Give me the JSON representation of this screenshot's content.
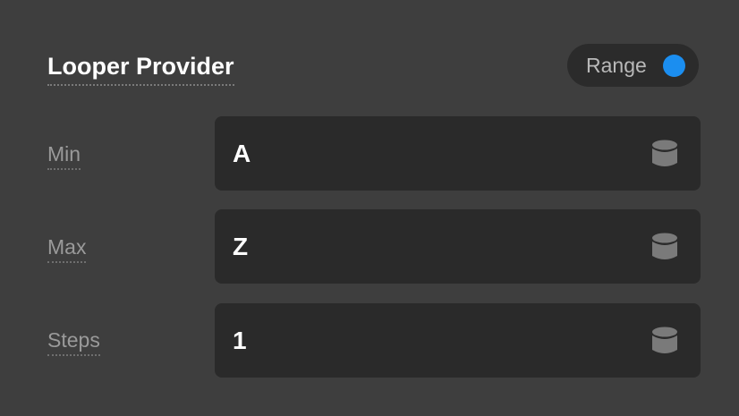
{
  "header": {
    "title": "Looper Provider",
    "range_label": "Range",
    "range_enabled": true,
    "range_color": "#1b8ef0"
  },
  "fields": [
    {
      "label": "Min",
      "value": "A",
      "icon": "database-icon"
    },
    {
      "label": "Max",
      "value": "Z",
      "icon": "database-icon"
    },
    {
      "label": "Steps",
      "value": "1",
      "icon": "database-icon"
    }
  ]
}
